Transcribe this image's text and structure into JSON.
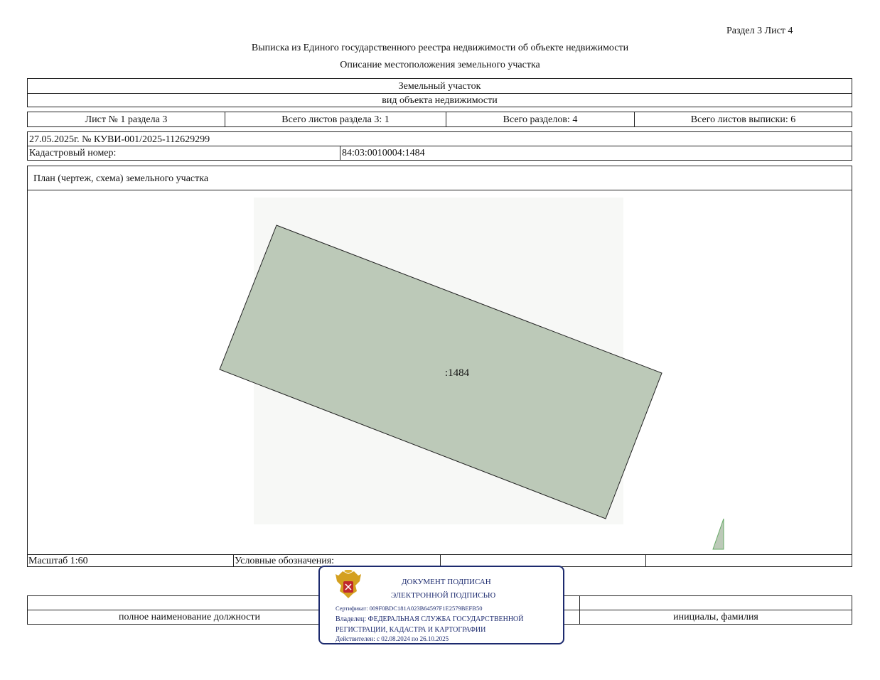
{
  "header": {
    "section_sheet": "Раздел 3    Лист 4",
    "title": "Выписка из Единого государственного реестра недвижимости об объекте недвижимости",
    "subtitle": "Описание местоположения земельного участка"
  },
  "object": {
    "type": "Земельный участок",
    "type_caption": "вид объекта недвижимости"
  },
  "sheets": {
    "sheet_of_section": "Лист № 1 раздела 3",
    "total_section_sheets": "Всего листов раздела 3: 1",
    "total_sections": "Всего разделов: 4",
    "total_extract_sheets": "Всего листов выписки: 6"
  },
  "record": {
    "date_number": "27.05.2025г. № КУВИ-001/2025-112629299",
    "cadastral_label": "Кадастровый номер:",
    "cadastral_number": "84:03:0010004:1484"
  },
  "plan": {
    "label": "План (чертеж, схема) земельного участка",
    "parcel_label": ":1484",
    "parcel_fill": "#bcc9b8",
    "scale": "Масштаб 1:60",
    "legend_label": "Условные обозначения:"
  },
  "signature": {
    "position_caption": "полное наименование должности",
    "name_caption": "инициалы, фамилия"
  },
  "stamp": {
    "line1": "ДОКУМЕНТ ПОДПИСАН",
    "line2": "ЭЛЕКТРОННОЙ ПОДПИСЬЮ",
    "certificate": "Сертификат: 009F0BDC181A023B64597F1E2579BEFB50",
    "owner1": "Владелец: ФЕДЕРАЛЬНАЯ СЛУЖБА ГОСУДАРСТВЕННОЙ",
    "owner2": "РЕГИСТРАЦИИ, КАДАСТРА И КАРТОГРАФИИ",
    "valid": "Действителен: с 02.08.2024 по 26.10.2025",
    "color": "#1c2a6e",
    "emblem": "russian-coat-of-arms-icon"
  }
}
